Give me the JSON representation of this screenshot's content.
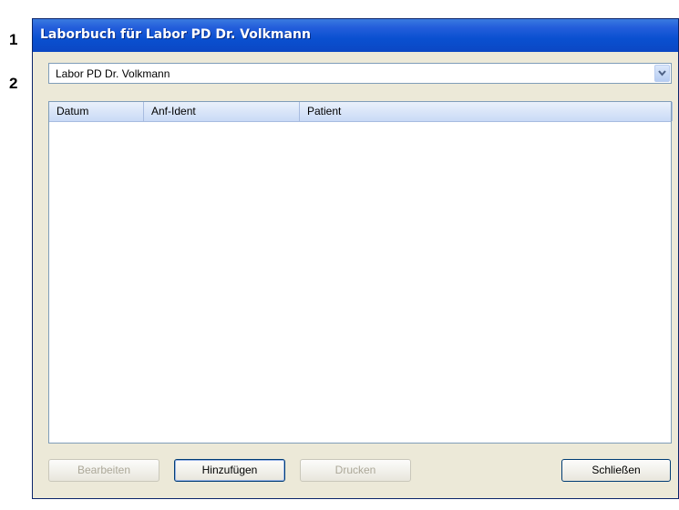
{
  "callouts": [
    "1",
    "2"
  ],
  "window": {
    "title": "Laborbuch für Labor PD Dr. Volkmann"
  },
  "lab_select": {
    "value": "Labor PD Dr. Volkmann"
  },
  "table": {
    "columns": [
      "Datum",
      "Anf-Ident",
      "Patient"
    ],
    "rows": []
  },
  "buttons": {
    "edit": "Bearbeiten",
    "add": "Hinzufügen",
    "print": "Drucken",
    "close": "Schließen"
  },
  "colors": {
    "titlebar": "#0a50d0",
    "dialog_bg": "#ece9d8",
    "header_bg": "#c9daf6",
    "disabled_text": "#aca899"
  }
}
